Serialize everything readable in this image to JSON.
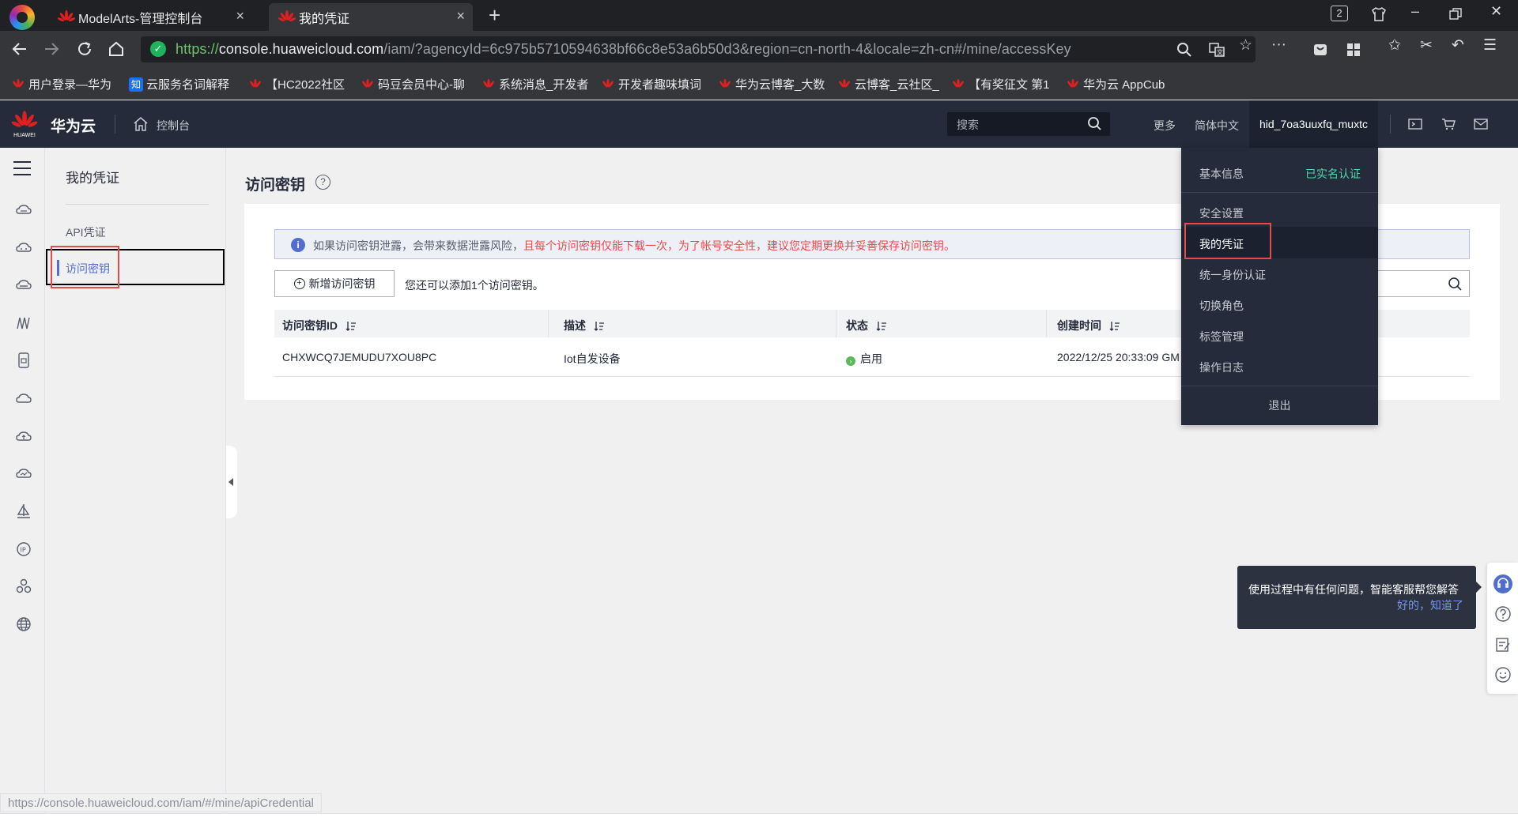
{
  "browser": {
    "tabs": [
      {
        "label": "ModelArts-管理控制台"
      },
      {
        "label": "我的凭证"
      }
    ],
    "tab_count_badge": "2",
    "url": {
      "proto": "https://",
      "host": "console.huaweicloud.com",
      "path": "/iam/?agencyId=6c975b5710594638bf66c8e53a6b50d3&region=cn-north-4&locale=zh-cn#/mine/accessKey"
    },
    "bookmarks": [
      {
        "label": "用户登录—华为",
        "icon": "huawei-flower-icon"
      },
      {
        "label": "云服务名词解释",
        "icon": "zhihu-icon",
        "icon_text": "知"
      },
      {
        "label": "【HC2022社区",
        "icon": "huawei-flower-icon"
      },
      {
        "label": "码豆会员中心-聊",
        "icon": "huawei-flower-icon"
      },
      {
        "label": "系统消息_开发者",
        "icon": "huawei-flower-icon"
      },
      {
        "label": "开发者趣味填词",
        "icon": "huawei-flower-icon"
      },
      {
        "label": "华为云博客_大数",
        "icon": "huawei-flower-icon"
      },
      {
        "label": "云博客_云社区_",
        "icon": "huawei-flower-icon"
      },
      {
        "label": "【有奖征文 第1",
        "icon": "huawei-flower-icon"
      },
      {
        "label": "华为云 AppCub",
        "icon": "huawei-flower-icon"
      }
    ],
    "status_url": "https://console.huaweicloud.com/iam/#/mine/apiCredential"
  },
  "header": {
    "logo_text": "HUAWEI",
    "brand": "华为云",
    "console": "控制台",
    "search_placeholder": "搜索",
    "more": "更多",
    "language": "简体中文",
    "username": "hid_7oa3uuxfq_muxtc"
  },
  "sidebar": {
    "title": "我的凭证",
    "items": [
      {
        "label": "API凭证"
      },
      {
        "label": "访问密钥"
      }
    ]
  },
  "main": {
    "title": "访问密钥",
    "notice_normal": "如果访问密钥泄露，会带来数据泄露风险，",
    "notice_warn": "且每个访问密钥仅能下载一次，为了帐号安全性，建议您定期更换并妥善保存访问密钥。",
    "add_button": "新增访问密钥",
    "add_hint": "您还可以添加1个访问密钥。",
    "columns": [
      "访问密钥ID",
      "描述",
      "状态",
      "创建时间"
    ],
    "rows": [
      {
        "id": "CHXWCQ7JEMUDU7XOU8PC",
        "desc": "Iot自发设备",
        "status": "启用",
        "created": "2022/12/25 20:33:09 GM"
      }
    ]
  },
  "user_menu": {
    "basic_info": "基本信息",
    "verified": "已实名认证",
    "items": [
      "安全设置",
      "我的凭证",
      "统一身份认证",
      "切换角色",
      "标签管理",
      "操作日志"
    ],
    "logout": "退出"
  },
  "assistant": {
    "tip": "使用过程中有任何问题，智能客服帮您解答",
    "ok": "好的，知道了"
  },
  "colors": {
    "accent": "#526ecc",
    "warn": "#e84a4a",
    "header_bg": "#252b3a",
    "success": "#5cb85c"
  }
}
